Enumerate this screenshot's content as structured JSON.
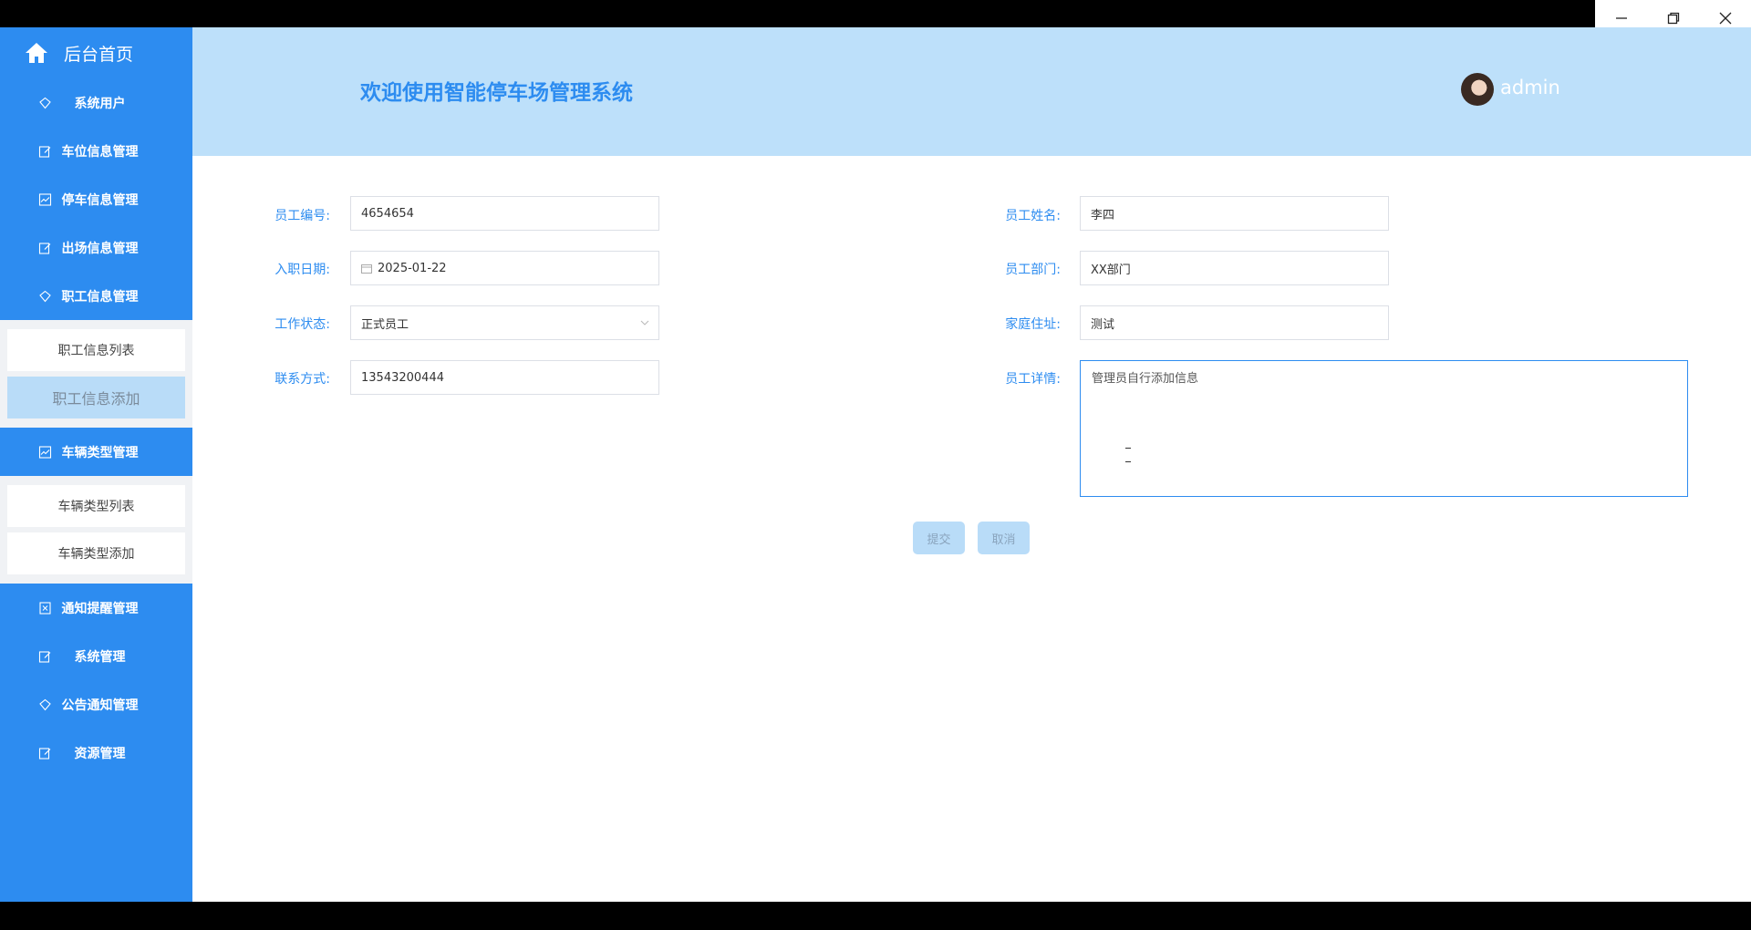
{
  "window": {
    "minimize": "—",
    "restore": "❐",
    "close": "✕"
  },
  "sidebar": {
    "home_label": "后台首页",
    "menu": [
      {
        "label": "系统用户"
      },
      {
        "label": "车位信息管理"
      },
      {
        "label": "停车信息管理"
      },
      {
        "label": "出场信息管理"
      },
      {
        "label": "职工信息管理"
      }
    ],
    "staff_sub": [
      {
        "label": "职工信息列表"
      },
      {
        "label": "职工信息添加"
      }
    ],
    "vehicle_type": {
      "label": "车辆类型管理"
    },
    "vehicle_sub": [
      {
        "label": "车辆类型列表"
      },
      {
        "label": "车辆类型添加"
      }
    ],
    "menu2": [
      {
        "label": "通知提醒管理"
      },
      {
        "label": "系统管理"
      },
      {
        "label": "公告通知管理"
      },
      {
        "label": "资源管理"
      }
    ]
  },
  "header": {
    "title": "欢迎使用智能停车场管理系统",
    "username": "admin"
  },
  "form": {
    "employee_no": {
      "label": "员工编号:",
      "value": "4654654"
    },
    "employee_name": {
      "label": "员工姓名:",
      "value": "李四"
    },
    "hire_date": {
      "label": "入职日期:",
      "value": "2025-01-22"
    },
    "department": {
      "label": "员工部门:",
      "value": "XX部门"
    },
    "work_status": {
      "label": "工作状态:",
      "value": "正式员工"
    },
    "address": {
      "label": "家庭住址:",
      "value": "测试"
    },
    "contact": {
      "label": "联系方式:",
      "value": "13543200444"
    },
    "details": {
      "label": "员工详情:",
      "value": "管理员自行添加信息"
    },
    "submit": "提交",
    "cancel": "取消"
  },
  "colors": {
    "primary": "#2d8cf0",
    "header_bg": "#bde0fa",
    "button_bg": "#b9dcf8"
  }
}
